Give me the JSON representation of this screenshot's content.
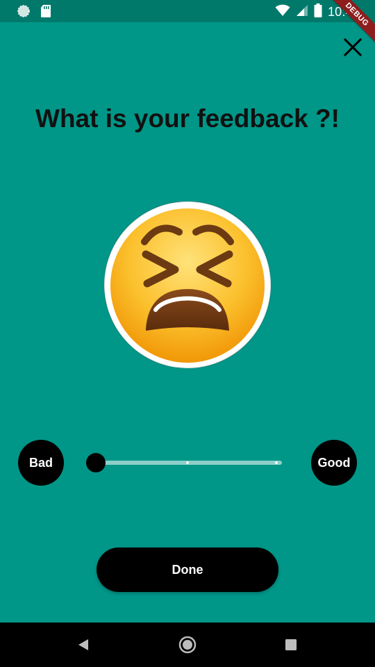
{
  "status_bar": {
    "time": "10:40",
    "debug_label": "DEBUG",
    "icons": [
      "sync-icon",
      "sd-card-icon",
      "wifi-icon",
      "signal-icon",
      "battery-icon"
    ]
  },
  "header": {
    "close_icon": "close-icon"
  },
  "main": {
    "title": "What is your feedback ?!",
    "emoji": "tired-face-emoji"
  },
  "rating": {
    "min_label": "Bad",
    "max_label": "Good",
    "value": 0,
    "min": 0,
    "max": 1,
    "divisions": 2
  },
  "footer": {
    "done_label": "Done"
  },
  "nav_bar": {
    "icons": [
      "back-icon",
      "home-icon",
      "recents-icon"
    ]
  },
  "colors": {
    "background": "#009688",
    "status_bar": "#00796b",
    "button": "#000000",
    "title_text": "#111111"
  }
}
